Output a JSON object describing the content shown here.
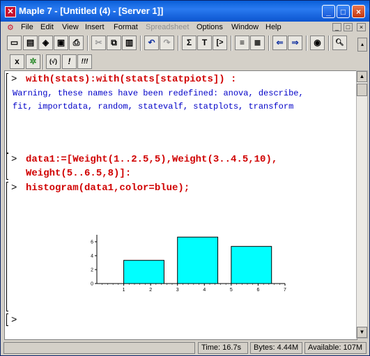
{
  "window": {
    "title": "Maple 7  - [Untitled (4) - [Server 1]]",
    "app_icon": "maple-x-icon"
  },
  "title_buttons": {
    "minimize": "_",
    "maximize": "□",
    "close": "×"
  },
  "menubar": [
    "File",
    "Edit",
    "View",
    "Insert",
    "Format",
    "Spreadsheet",
    "Options",
    "Window",
    "Help"
  ],
  "mdi_buttons": [
    "_",
    "□",
    "×"
  ],
  "toolbar1": [
    "new",
    "open",
    "open-url",
    "save",
    "print",
    "cut",
    "copy",
    "paste",
    "undo",
    "redo",
    "sigma",
    "T",
    "prompt",
    "collapse",
    "expand",
    "back",
    "forward",
    "stop",
    "zoom"
  ],
  "toolbar1_glyphs": {
    "sigma": "Σ",
    "T": "T",
    "prompt": "[>"
  },
  "toolbar2": {
    "x": "x",
    "leaf": "✲",
    "sqrt": "(√)",
    "bang": "!",
    "triple": "!!!"
  },
  "worksheet": {
    "prompt": ">",
    "lines": [
      {
        "kind": "input",
        "text": "with(stats):with(stats[statpiots]) :"
      },
      {
        "kind": "output",
        "text": "Warning, these names have been redefined: anova, describe,"
      },
      {
        "kind": "output",
        "text": "fit, importdata, random, statevalf, statplots, transform"
      },
      {
        "kind": "input",
        "text": "data1:=[Weight(1..2.5,5),Weight(3..4.5,10),"
      },
      {
        "kind": "input",
        "text": "Weight(5..6.5,8)]:"
      },
      {
        "kind": "input",
        "text": "histogram(data1,color=blue);"
      }
    ]
  },
  "chart_data": {
    "type": "bar",
    "title": "",
    "xlabel": "",
    "ylabel": "",
    "bars": [
      {
        "x0": 1,
        "x1": 2.5,
        "height": 3.33
      },
      {
        "x0": 3,
        "x1": 4.5,
        "height": 6.67
      },
      {
        "x0": 5,
        "x1": 6.5,
        "height": 5.33
      }
    ],
    "xticks": [
      "1",
      "2",
      "3",
      "4",
      "5",
      "6",
      "7"
    ],
    "yticks": [
      "0",
      "2",
      "4",
      "6"
    ],
    "xlim": [
      0,
      7
    ],
    "ylim": [
      0,
      7
    ],
    "color": "#00ffff"
  },
  "status": {
    "time": "Time:  16.7s",
    "bytes": "Bytes: 4.44M",
    "available": "Available: 107M"
  }
}
